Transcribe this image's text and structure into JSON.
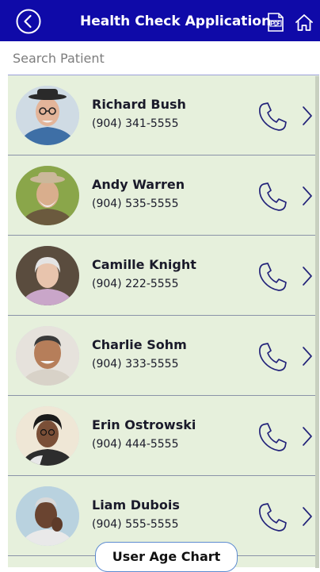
{
  "header": {
    "title": "Health Check Application",
    "back_icon": "back-circle-icon",
    "pdf_icon": "pdf-icon",
    "home_icon": "home-icon"
  },
  "search": {
    "placeholder": "Search Patient",
    "value": ""
  },
  "patients": [
    {
      "name": "Richard Bush",
      "phone": "(904) 341-5555"
    },
    {
      "name": "Andy Warren",
      "phone": "(904) 535-5555"
    },
    {
      "name": "Camille Knight",
      "phone": "(904) 222-5555"
    },
    {
      "name": "Charlie Sohm",
      "phone": "(904) 333-5555"
    },
    {
      "name": "Erin Ostrowski",
      "phone": "(904) 444-5555"
    },
    {
      "name": "Liam Dubois",
      "phone": "(904) 555-5555"
    }
  ],
  "row_icons": {
    "call": "phone-icon",
    "open": "chevron-right-icon"
  },
  "footer": {
    "chart_button_label": "User Age Chart"
  },
  "colors": {
    "header_bg": "#0f0aa8",
    "list_bg": "#e6f0dc",
    "icon_color": "#23237a"
  }
}
